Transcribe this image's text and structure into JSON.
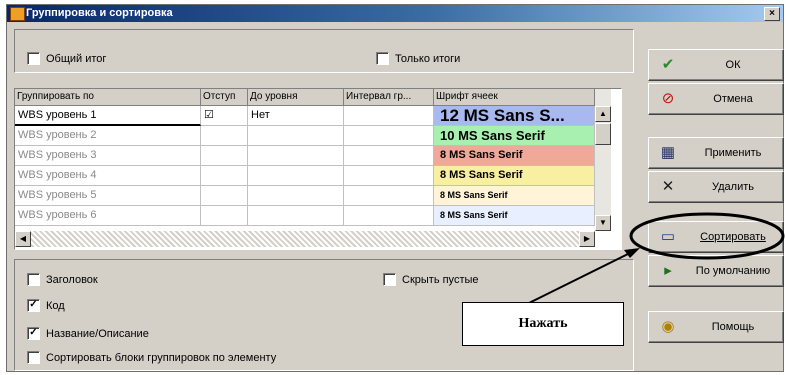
{
  "window": {
    "title": "Группировка и сортировка",
    "close_glyph": "×"
  },
  "top_checks": [
    {
      "label": "Общий итог",
      "checked": false
    },
    {
      "label": "Только итоги",
      "checked": false
    }
  ],
  "grid": {
    "columns": [
      "Группировать по",
      "Отступ",
      "До уровня",
      "Интервал гр...",
      "Шрифт ячеек"
    ],
    "rows": [
      {
        "group": "WBS уровень 1",
        "indent": "☑",
        "level": "Нет",
        "interval": "",
        "font": "12 MS Sans S...",
        "font_bg": "#a8b8f0",
        "font_size": 17
      },
      {
        "group": "WBS уровень 2",
        "indent": "",
        "level": "",
        "interval": "",
        "font": "10 MS Sans Serif",
        "font_bg": "#a8f0b0",
        "font_size": 13
      },
      {
        "group": "WBS уровень 3",
        "indent": "",
        "level": "",
        "interval": "",
        "font": "8 MS Sans Serif",
        "font_bg": "#f0a898",
        "font_size": 11
      },
      {
        "group": "WBS уровень 4",
        "indent": "",
        "level": "",
        "interval": "",
        "font": "8 MS Sans Serif",
        "font_bg": "#f8f0a0",
        "font_size": 11
      },
      {
        "group": "WBS уровень 5",
        "indent": "",
        "level": "",
        "interval": "",
        "font": "8 MS Sans Serif",
        "font_bg": "#fff4d8",
        "font_size": 9
      },
      {
        "group": "WBS уровень 6",
        "indent": "",
        "level": "",
        "interval": "",
        "font": "8 MS Sans Serif",
        "font_bg": "#e8f0ff",
        "font_size": 9
      }
    ]
  },
  "bottom_checks": [
    {
      "label": "Заголовок",
      "checked": false
    },
    {
      "label": "Скрыть пустые",
      "checked": false
    },
    {
      "label": "Код",
      "checked": true
    },
    {
      "label": "Название/Описание",
      "checked": true
    },
    {
      "label": "Сортировать блоки группировок по элементу",
      "checked": false
    }
  ],
  "buttons": [
    {
      "label": "ОК",
      "icon": "✔",
      "icon_color": "#2a8a2a"
    },
    {
      "label": "Отмена",
      "icon": "⊘",
      "icon_color": "#c01010"
    },
    {
      "label": "Применить",
      "icon": "▦",
      "icon_color": "#203060"
    },
    {
      "label": "Удалить",
      "icon": "✕",
      "icon_color": "#202020"
    },
    {
      "label": "Сортировать",
      "icon": "▭",
      "icon_color": "#1a3a90"
    },
    {
      "label": "По умолчанию",
      "icon": "▸",
      "icon_color": "#207020"
    },
    {
      "label": "Помощь",
      "icon": "◉",
      "icon_color": "#b08000"
    }
  ],
  "callout": {
    "text": "Нажать"
  }
}
